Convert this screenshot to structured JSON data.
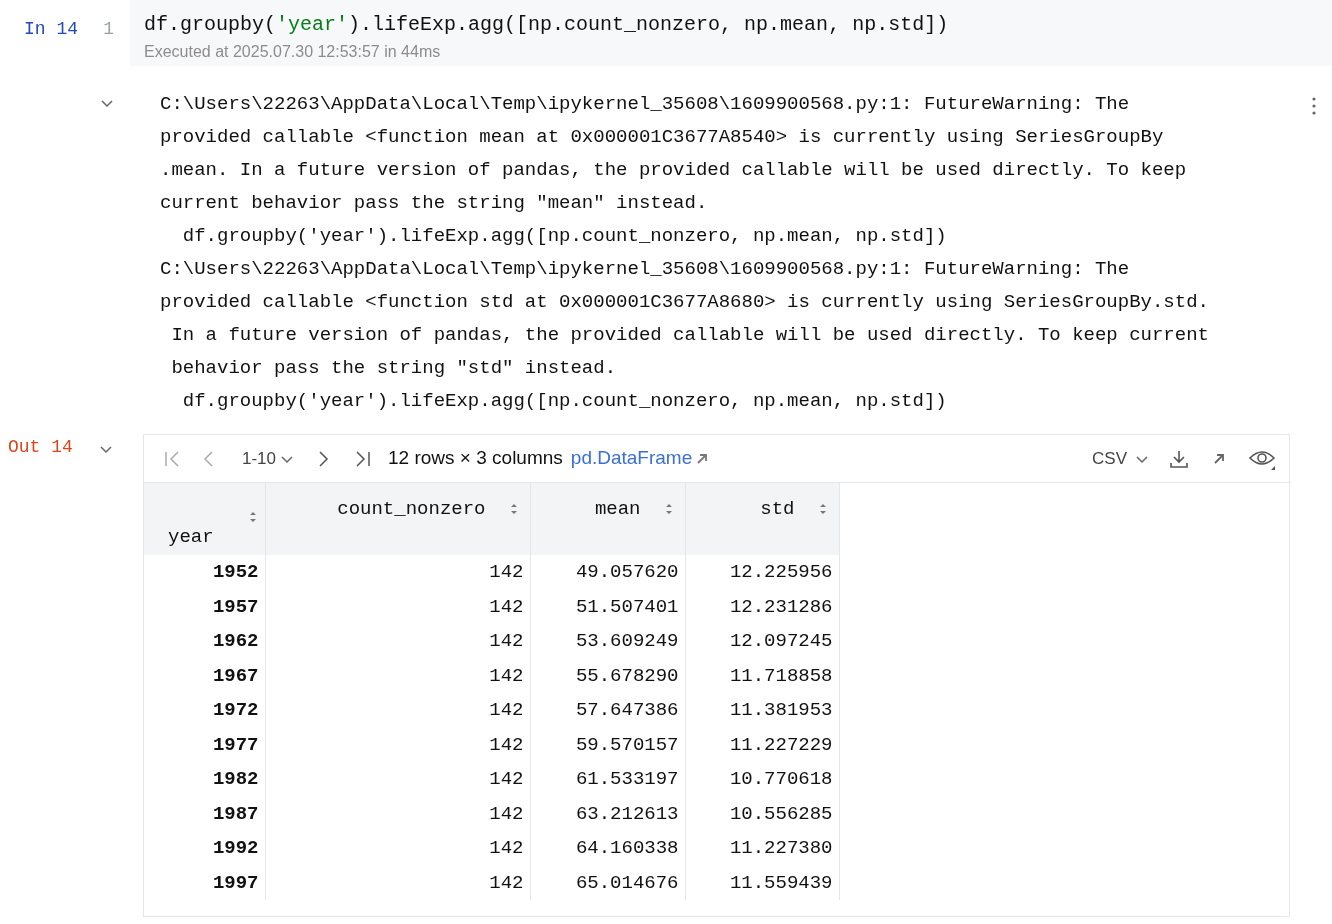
{
  "input_cell": {
    "prompt": "In 14",
    "line_number": "1",
    "code_tokens": [
      {
        "kind": "plain",
        "text": "df.groupby("
      },
      {
        "kind": "string",
        "text": "'year'"
      },
      {
        "kind": "plain",
        "text": ").lifeExp.agg([np.count_nonzero, np.mean, np.std])"
      }
    ],
    "execution_info": "Executed at 2025.07.30 12:53:57 in 44ms"
  },
  "stderr_output": {
    "expanded": true,
    "lines": [
      "C:\\Users\\22263\\AppData\\Local\\Temp\\ipykernel_35608\\1609900568.py:1: FutureWarning: The",
      "provided callable <function mean at 0x000001C3677A8540> is currently using SeriesGroupBy",
      ".mean. In a future version of pandas, the provided callable will be used directly. To keep",
      "current behavior pass the string \"mean\" instead.",
      "  df.groupby('year').lifeExp.agg([np.count_nonzero, np.mean, np.std])",
      "C:\\Users\\22263\\AppData\\Local\\Temp\\ipykernel_35608\\1609900568.py:1: FutureWarning: The",
      "provided callable <function std at 0x000001C3677A8680> is currently using SeriesGroupBy.std.",
      " In a future version of pandas, the provided callable will be used directly. To keep current",
      " behavior pass the string \"std\" instead.",
      "  df.groupby('year').lifeExp.agg([np.count_nonzero, np.mean, np.std])"
    ]
  },
  "output_cell": {
    "prompt": "Out 14",
    "expanded": true,
    "toolbar": {
      "page_range": "1-10",
      "summary": "12 rows × 3 columns",
      "type_link": "pd.DataFrame",
      "export_format": "CSV"
    },
    "table": {
      "index_name": "year",
      "columns": [
        "count_nonzero",
        "mean",
        "std"
      ],
      "rows": [
        {
          "index": "1952",
          "values": [
            "142",
            "49.057620",
            "12.225956"
          ]
        },
        {
          "index": "1957",
          "values": [
            "142",
            "51.507401",
            "12.231286"
          ]
        },
        {
          "index": "1962",
          "values": [
            "142",
            "53.609249",
            "12.097245"
          ]
        },
        {
          "index": "1967",
          "values": [
            "142",
            "55.678290",
            "11.718858"
          ]
        },
        {
          "index": "1972",
          "values": [
            "142",
            "57.647386",
            "11.381953"
          ]
        },
        {
          "index": "1977",
          "values": [
            "142",
            "59.570157",
            "11.227229"
          ]
        },
        {
          "index": "1982",
          "values": [
            "142",
            "61.533197",
            "10.770618"
          ]
        },
        {
          "index": "1987",
          "values": [
            "142",
            "63.212613",
            "10.556285"
          ]
        },
        {
          "index": "1992",
          "values": [
            "142",
            "64.160338",
            "11.227380"
          ]
        },
        {
          "index": "1997",
          "values": [
            "142",
            "65.014676",
            "11.559439"
          ]
        }
      ]
    }
  }
}
